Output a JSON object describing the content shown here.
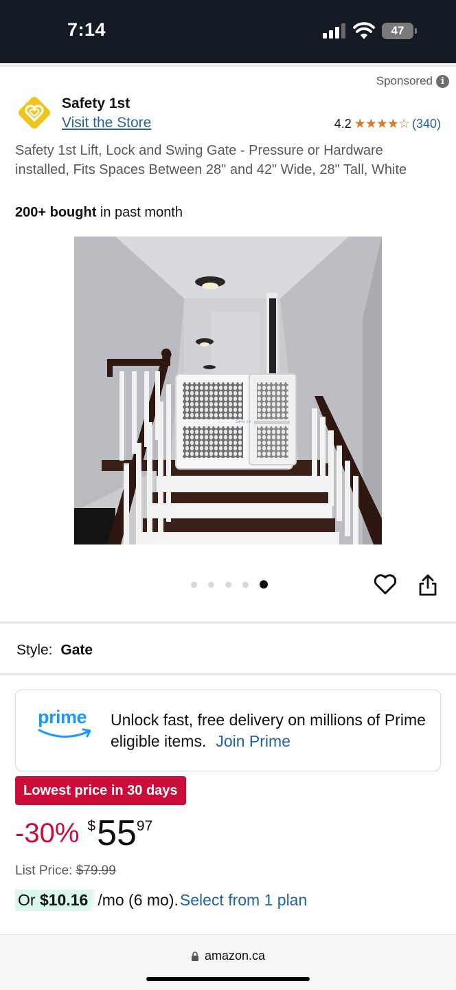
{
  "status_bar": {
    "time": "7:14",
    "battery": "47"
  },
  "ad": {
    "sponsored_label": "Sponsored",
    "info_icon": "i"
  },
  "brand": {
    "name": "Safety 1st",
    "visit_store": "Visit the Store"
  },
  "rating": {
    "value": "4.2",
    "stars": "★★★★☆",
    "count": "(340)"
  },
  "product": {
    "title": "Safety 1st Lift, Lock and Swing Gate - Pressure or Hardware installed, Fits Spaces Between 28\" and 42\" Wide, 28\" Tall, White",
    "bought_bold": "200+ bought",
    "bought_rest": "in past month",
    "image_alt": "White safety gate at the top of a staircase",
    "gate_brand_mark": "Safety 1st"
  },
  "carousel": {
    "total": 5,
    "active_index": 4
  },
  "style": {
    "label": "Style:",
    "value": "Gate"
  },
  "prime": {
    "logo": "prime",
    "text": "Unlock fast, free delivery on millions of Prime eligible items.",
    "join": "Join Prime"
  },
  "deal": {
    "badge": "Lowest price in 30 days"
  },
  "price": {
    "discount": "-30%",
    "currency": "$",
    "whole": "55",
    "fraction": "97",
    "list_label": "List Price:",
    "list_value": "$79.99"
  },
  "financing": {
    "prefix": "Or",
    "amount": "$10.16",
    "term": "/mo (6 mo).",
    "select": "Select from 1 plan"
  },
  "browser": {
    "url": "amazon.ca"
  },
  "colors": {
    "brand_yellow": "#f2c318",
    "link": "#2162a1",
    "deal_red": "#cc0c39",
    "star": "#de7921",
    "prime_blue": "#1a98ff"
  }
}
